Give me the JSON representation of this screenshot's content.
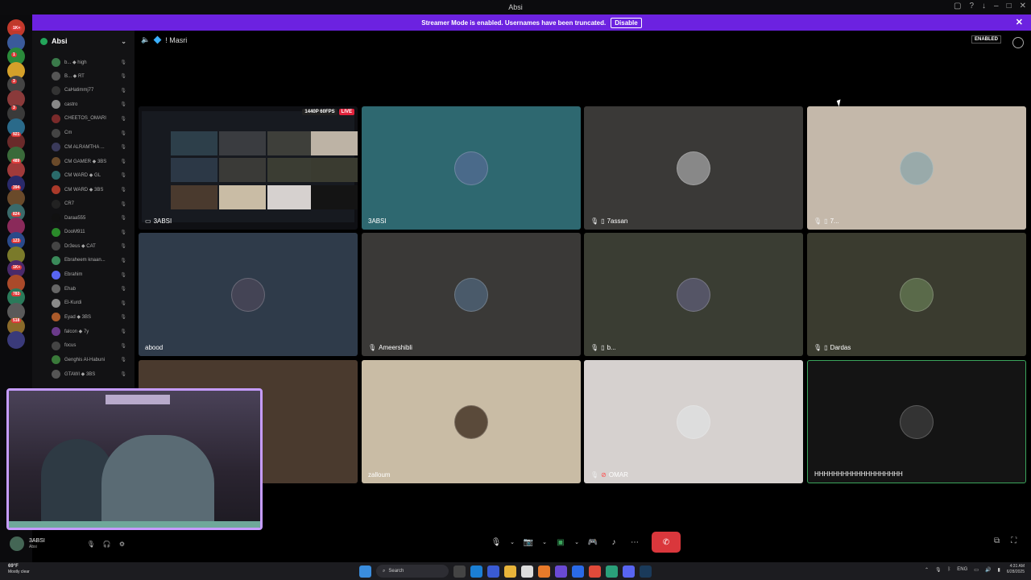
{
  "window": {
    "title": "Absi"
  },
  "banner": {
    "text": "Streamer Mode is enabled. Usernames have been truncated.",
    "disable_label": "Disable"
  },
  "server": {
    "name": "Absi"
  },
  "members": [
    {
      "name": "b...",
      "tag": "high",
      "color": "#3a7a4a"
    },
    {
      "name": "B...",
      "tag": "RT",
      "color": "#555"
    },
    {
      "name": "CaHatimmj77",
      "tag": "",
      "color": "#333"
    },
    {
      "name": "castro",
      "tag": "",
      "color": "#888"
    },
    {
      "name": "CHEETOS_OMARI",
      "tag": "",
      "color": "#7a2a2a"
    },
    {
      "name": "Cm",
      "tag": "",
      "color": "#444"
    },
    {
      "name": "CM ALRAMTHA ...",
      "tag": "",
      "color": "#3a3a5a"
    },
    {
      "name": "CM GAMER",
      "tag": "3BS",
      "color": "#6a4a2a"
    },
    {
      "name": "CM WARD",
      "tag": "GL",
      "color": "#2a6a6a"
    },
    {
      "name": "CM WARD",
      "tag": "3BS",
      "color": "#aa3a2a"
    },
    {
      "name": "CR7",
      "tag": "",
      "color": "#222"
    },
    {
      "name": "Daraa555",
      "tag": "",
      "color": "#111"
    },
    {
      "name": "DooM911",
      "tag": "",
      "color": "#2a8a2a"
    },
    {
      "name": "Dr3eus",
      "tag": "CAT",
      "color": "#444"
    },
    {
      "name": "Ebraheem knaan...",
      "tag": "",
      "color": "#3a8a5a"
    },
    {
      "name": "Ebrahim",
      "tag": "",
      "color": "#5865f2"
    },
    {
      "name": "Ehab",
      "tag": "",
      "color": "#666"
    },
    {
      "name": "El-Kurdi",
      "tag": "",
      "color": "#8a8a8a"
    },
    {
      "name": "Eyad",
      "tag": "3BS",
      "color": "#aa5a2a"
    },
    {
      "name": "falcon",
      "tag": "7y",
      "color": "#6a3a8a"
    },
    {
      "name": "focus",
      "tag": "",
      "color": "#444"
    },
    {
      "name": "Genghis Al-Habuni",
      "tag": "",
      "color": "#3a7a3a"
    },
    {
      "name": "GTAWI",
      "tag": "3BS",
      "color": "#555"
    }
  ],
  "voice_channel": {
    "name": "Masri"
  },
  "enabled_badge": "ENABLED",
  "stream": {
    "quality": "1440P 60FPS",
    "live": "LIVE",
    "label": "3ABSI"
  },
  "tiles": [
    {
      "label": "3ABSI",
      "bg": "#2e6870",
      "icons": ""
    },
    {
      "label": "7assan",
      "bg": "#3a3937",
      "icons": "muted-phone"
    },
    {
      "label": "7...",
      "bg": "#c4b8aa",
      "icons": "muted-phone"
    },
    {
      "label": "abood",
      "bg": "#2f3b4a",
      "icons": ""
    },
    {
      "label": "Ameershibli",
      "bg": "#3a3937",
      "icons": "muted"
    },
    {
      "label": "b...",
      "bg": "#3a3d33",
      "icons": "muted-phone"
    },
    {
      "label": "Dardas",
      "bg": "#3a3b2f",
      "icons": "muted-phone"
    },
    {
      "label": "",
      "bg": "#4a3a2e",
      "icons": ""
    },
    {
      "label": "zalloum",
      "bg": "#c9bca5",
      "icons": ""
    },
    {
      "label": "OMAR",
      "bg": "#d6d1cf",
      "icons": "muted-red"
    },
    {
      "label": "HHHHHHHHHHHHHHHHHHH",
      "bg": "#141414",
      "icons": ""
    }
  ],
  "user_panel": {
    "name": "3ABSI",
    "status": "Absi"
  },
  "taskbar": {
    "weather_temp": "69°F",
    "weather_desc": "Mostly clear",
    "search": "Search",
    "lang": "ENG",
    "time": "4:31 AM",
    "date": "6/28/2025"
  },
  "guild_badges": [
    "1K+",
    "1",
    "3",
    "3",
    "921",
    "489",
    "394",
    "824",
    "123",
    "1K+",
    "783",
    "518"
  ]
}
